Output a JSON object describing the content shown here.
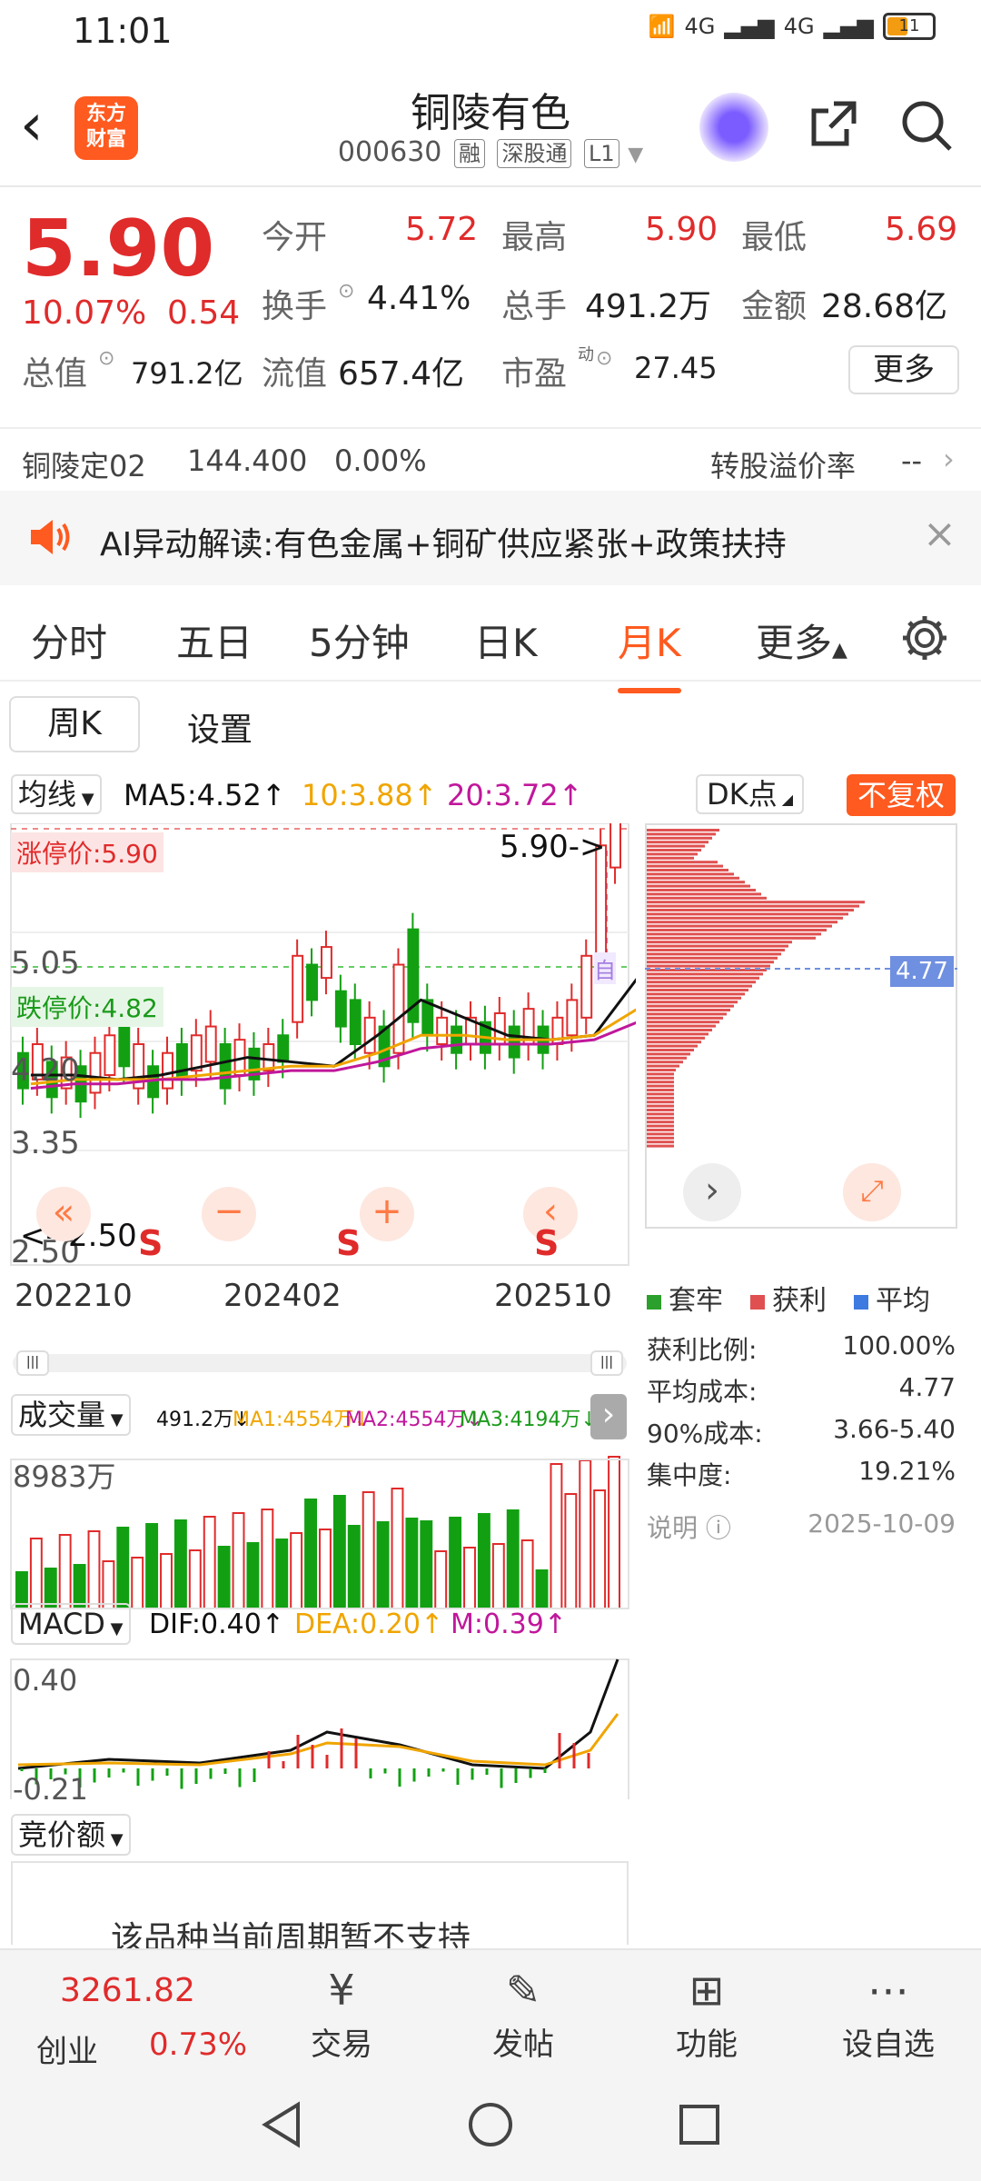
{
  "status": {
    "time": "11:01",
    "net1": "4G",
    "net2": "4G",
    "battery": "11"
  },
  "header": {
    "back_icon": "chevron-left-icon",
    "logo_line1": "东方",
    "logo_line2": "财富",
    "title": "铜陵有色",
    "code": "000630",
    "tags": [
      "融",
      "深股通",
      "L1"
    ]
  },
  "quote": {
    "price": "5.90",
    "change_pct": "10.07%",
    "change": "0.54",
    "open_label": "今开",
    "open": "5.72",
    "high_label": "最高",
    "high": "5.90",
    "low_label": "最低",
    "low": "5.69",
    "turnover_label": "换手",
    "turnover": "4.41%",
    "volume_label": "总手",
    "volume": "491.2万",
    "amount_label": "金额",
    "amount": "28.68亿",
    "mktcap_label": "总值",
    "mktcap": "791.2亿",
    "float_label": "流值",
    "float": "657.4亿",
    "pe_label": "市盈",
    "pe_sup": "动",
    "pe": "27.45",
    "more": "更多"
  },
  "bond": {
    "name": "铜陵定02",
    "price": "144.400",
    "pct": "0.00%",
    "premium_label": "转股溢价率",
    "premium": "--"
  },
  "ai": {
    "text": "AI异动解读:有色金属+铜矿供应紧张+政策扶持"
  },
  "tabs": [
    "分时",
    "五日",
    "5分钟",
    "日K",
    "月K",
    "更多"
  ],
  "active_tab": "月K",
  "subtabs": {
    "week": "周K",
    "settings": "设置"
  },
  "kline": {
    "ma_label": "均线",
    "ma5": "MA5:4.52↑",
    "ma10": "10:3.88↑",
    "ma20": "20:3.72↑",
    "dk": "DK点",
    "adjust": "不复权",
    "limit_up": "涨停价:5.90",
    "limit_down": "跌停价:4.82",
    "price_arrow": "5.90->",
    "low_arrow": "<--2.50",
    "y_labels": [
      "5.05",
      "4.20",
      "3.35",
      "2.50"
    ],
    "x_labels": [
      "202210",
      "202402",
      "202510"
    ],
    "profile_label": "4.77",
    "zi": "自"
  },
  "volume": {
    "label": "成交量",
    "vol": "491.2万↓",
    "ma1": "MA1:4554万↓",
    "ma2": "MA2:4554万↓",
    "ma3": "MA3:4194万↓",
    "max": "8983万"
  },
  "macd": {
    "label": "MACD",
    "dif": "DIF:0.40↑",
    "dea": "DEA:0.20↑",
    "m": "M:0.39↑",
    "top": "0.40",
    "bottom": "-0.21"
  },
  "auction": {
    "label": "竞价额",
    "msg": "该品种当前周期暂不支持"
  },
  "chips": {
    "legend": [
      "套牢",
      "获利",
      "平均"
    ],
    "rows": [
      {
        "k": "获利比例:",
        "v": "100.00%"
      },
      {
        "k": "平均成本:",
        "v": "4.77"
      },
      {
        "k": "90%成本:",
        "v": "3.66-5.40"
      },
      {
        "k": "集中度:",
        "v": "19.21%"
      }
    ],
    "note": "说明",
    "date": "2025-10-09"
  },
  "bottomnav": {
    "index_value": "3261.82",
    "index_name": "创业",
    "index_pct": "0.73%",
    "items": [
      "交易",
      "发帖",
      "功能",
      "设自选"
    ]
  },
  "colors": {
    "up": "#e02b2b",
    "down": "#12a012",
    "accent": "#ff5a1f",
    "ma5": "#111111",
    "ma10": "#f0a500",
    "ma20": "#c0179b"
  }
}
